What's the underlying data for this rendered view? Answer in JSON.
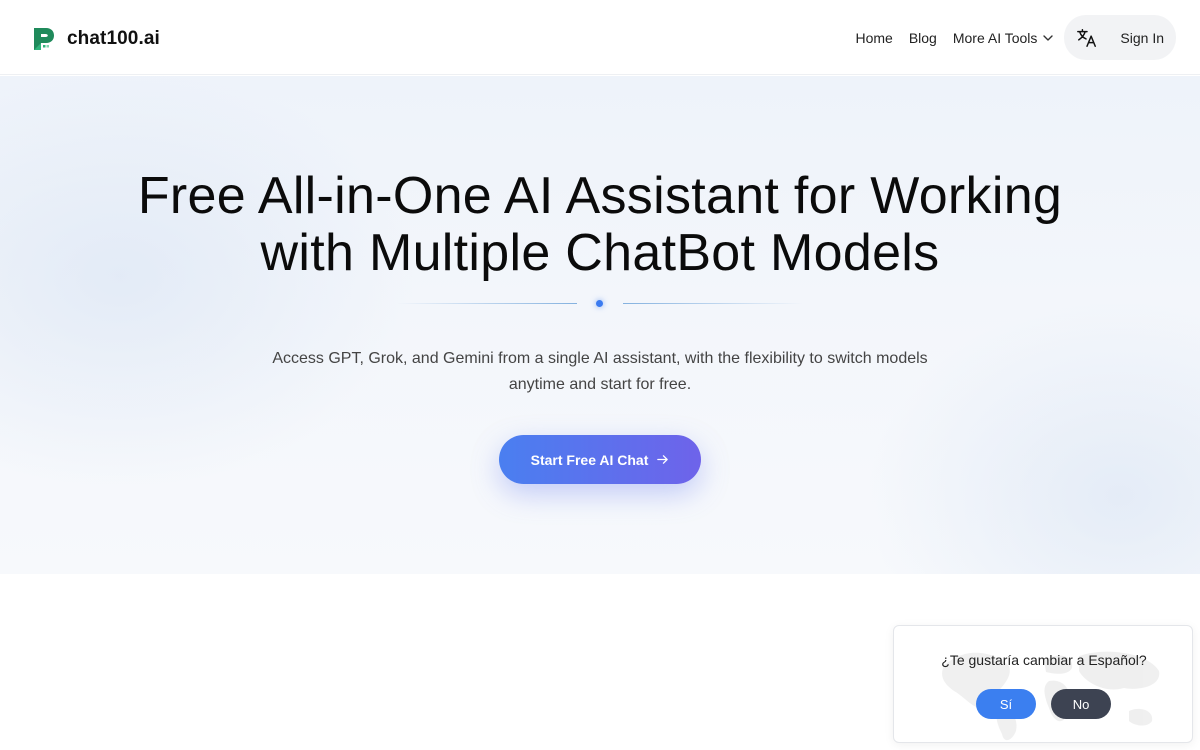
{
  "header": {
    "brand": "chat100.ai",
    "nav": {
      "home": "Home",
      "blog": "Blog",
      "more_tools": "More AI Tools"
    },
    "sign_in": "Sign In",
    "icons": [
      "logo-icon",
      "chevron-down-icon",
      "translate-icon"
    ]
  },
  "hero": {
    "title_line1": "Free All-in-One AI Assistant for Working",
    "title_line2": "with Multiple ChatBot Models",
    "subtitle_line1": "Access GPT, Grok, and Gemini from a single AI assistant, with the flexibility to switch models",
    "subtitle_line2": "anytime and start for free.",
    "cta_label": "Start Free AI Chat"
  },
  "language_prompt": {
    "question": "¿Te gustaría cambiar a Español?",
    "yes_label": "Sí",
    "no_label": "No"
  },
  "colors": {
    "accent_blue": "#3b7ff0",
    "cta_gradient_start": "#4a7ff0",
    "cta_gradient_end": "#6e63ea",
    "brand_green": "#1f8a5b",
    "no_button": "#3d4352"
  }
}
